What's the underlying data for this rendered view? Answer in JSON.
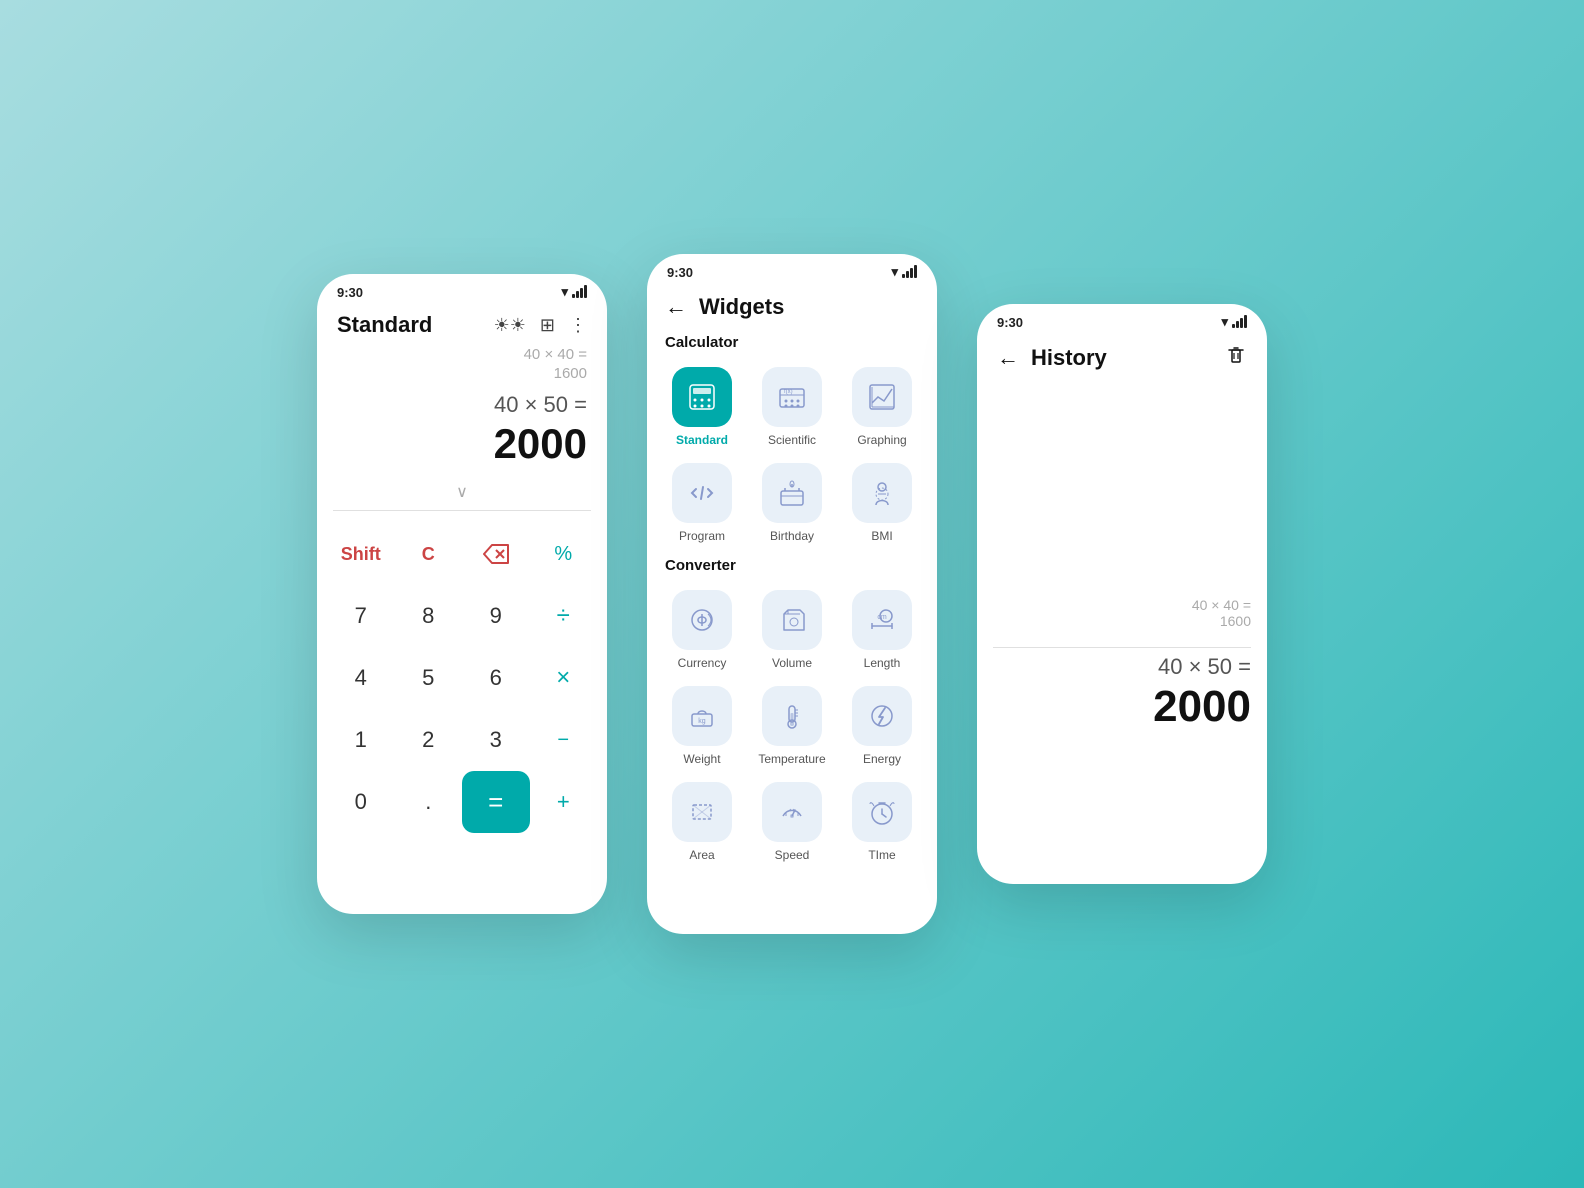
{
  "phone1": {
    "status": {
      "time": "9:30"
    },
    "title": "Standard",
    "history_expr": "40 × 40 =",
    "history_result": "1600",
    "current_expr": "40 × 50 =",
    "current_result": "2000",
    "keys": [
      {
        "label": "Shift",
        "type": "special"
      },
      {
        "label": "C",
        "type": "special"
      },
      {
        "label": "⌫",
        "type": "backspace"
      },
      {
        "label": "%",
        "type": "percent"
      },
      {
        "label": "7",
        "type": "num"
      },
      {
        "label": "8",
        "type": "num"
      },
      {
        "label": "9",
        "type": "num"
      },
      {
        "label": "÷",
        "type": "operator"
      },
      {
        "label": "4",
        "type": "num"
      },
      {
        "label": "5",
        "type": "num"
      },
      {
        "label": "6",
        "type": "num"
      },
      {
        "label": "×",
        "type": "operator"
      },
      {
        "label": "1",
        "type": "num"
      },
      {
        "label": "2",
        "type": "num"
      },
      {
        "label": "3",
        "type": "num"
      },
      {
        "label": "−",
        "type": "minus-key"
      },
      {
        "label": "0",
        "type": "num"
      },
      {
        "label": ".",
        "type": "num"
      },
      {
        "label": "=",
        "type": "equals"
      },
      {
        "label": "+",
        "type": "plus-key"
      }
    ]
  },
  "phone2": {
    "status": {
      "time": "9:30"
    },
    "title": "Widgets",
    "section_calculator": "Calculator",
    "section_converter": "Converter",
    "calculator_widgets": [
      {
        "label": "Standard",
        "active": true
      },
      {
        "label": "Scientific",
        "active": false
      },
      {
        "label": "Graphing",
        "active": false
      },
      {
        "label": "Program",
        "active": false
      },
      {
        "label": "Birthday",
        "active": false
      },
      {
        "label": "BMI",
        "active": false
      }
    ],
    "converter_widgets": [
      {
        "label": "Currency",
        "active": false
      },
      {
        "label": "Volume",
        "active": false
      },
      {
        "label": "Length",
        "active": false
      },
      {
        "label": "Weight",
        "active": false
      },
      {
        "label": "Temperature",
        "active": false
      },
      {
        "label": "Energy",
        "active": false
      },
      {
        "label": "Area",
        "active": false
      },
      {
        "label": "Speed",
        "active": false
      },
      {
        "label": "TIme",
        "active": false
      }
    ]
  },
  "phone3": {
    "status": {
      "time": "9:30"
    },
    "title": "History",
    "history_expr": "40 × 40 =",
    "history_result": "1600",
    "current_expr": "40 × 50 =",
    "current_result": "2000"
  }
}
